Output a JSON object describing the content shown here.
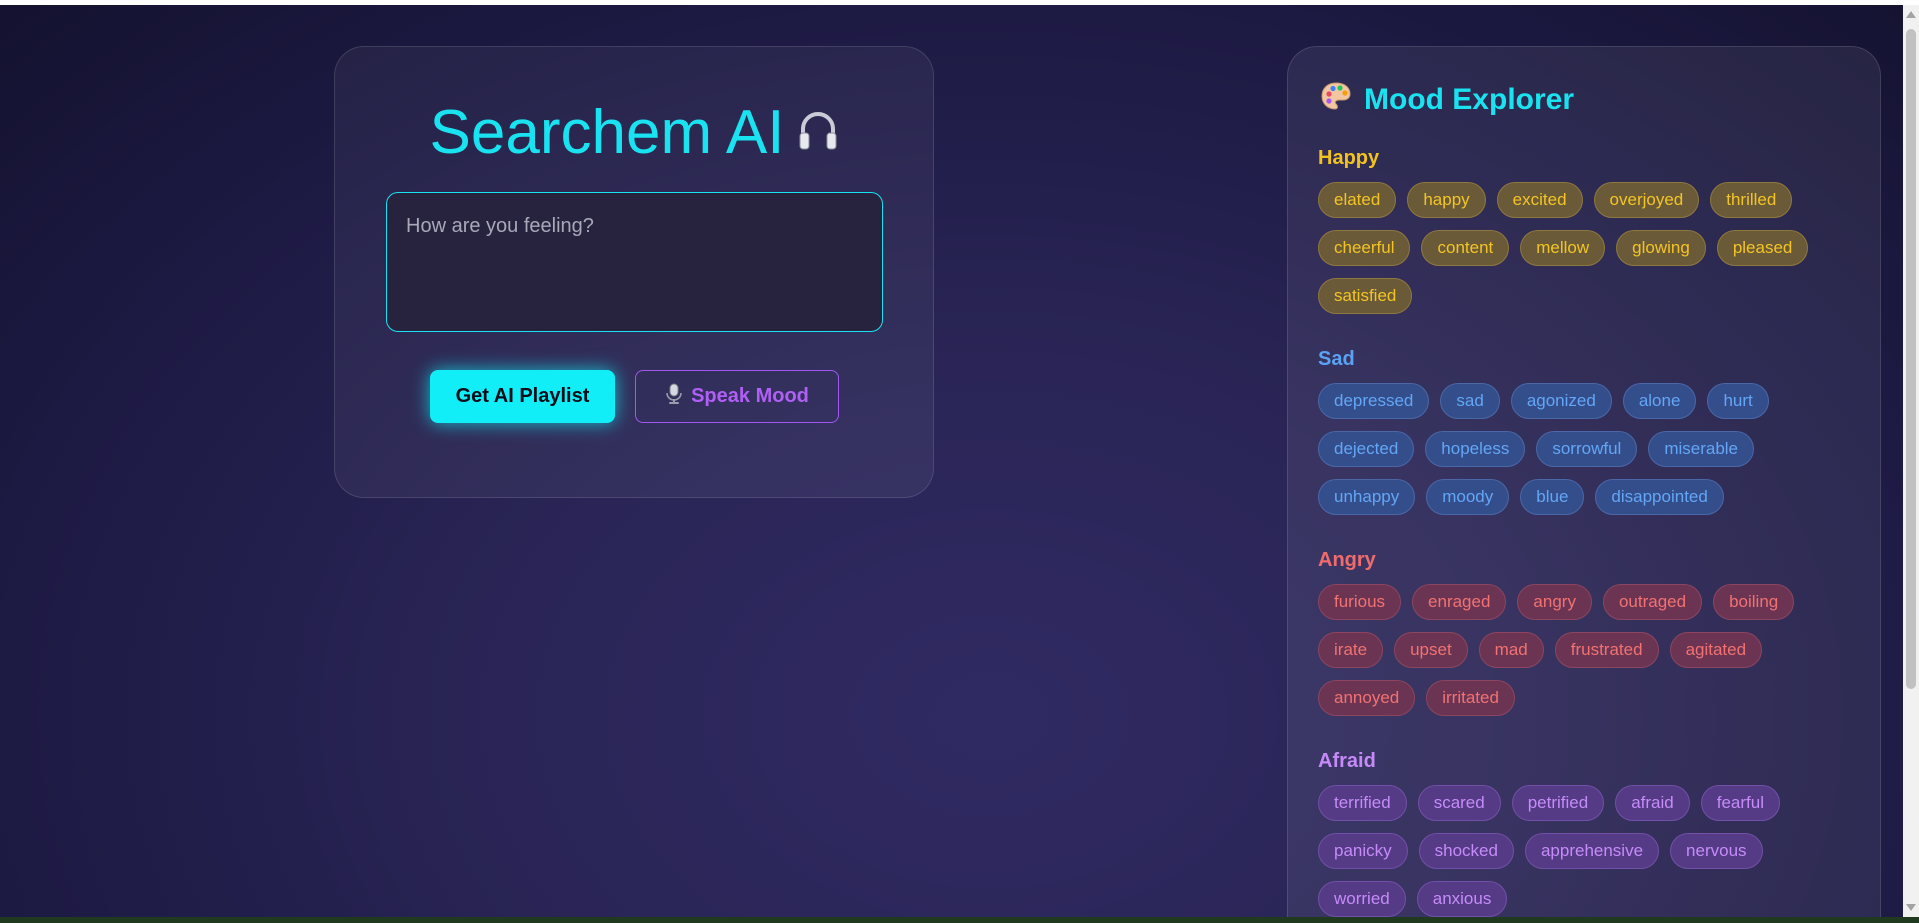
{
  "colors": {
    "accent": "#19e3f0",
    "secondary": "#b05ff5",
    "happy": "#f3c524",
    "sad": "#63a6f5",
    "angry": "#f27272",
    "afraid": "#c58cf8"
  },
  "search": {
    "title": "Searchem AI",
    "title_icon": "headphones-icon",
    "input_value": "",
    "input_placeholder": "How are you feeling?",
    "primary_button": "Get AI Playlist",
    "secondary_button": "Speak Mood",
    "secondary_button_icon": "microphone-icon"
  },
  "explorer": {
    "title": "Mood Explorer",
    "title_icon": "palette-icon",
    "moods": [
      {
        "name": "Happy",
        "words": [
          "elated",
          "happy",
          "excited",
          "overjoyed",
          "thrilled",
          "cheerful",
          "content",
          "mellow",
          "glowing",
          "pleased",
          "satisfied"
        ]
      },
      {
        "name": "Sad",
        "words": [
          "depressed",
          "sad",
          "agonized",
          "alone",
          "hurt",
          "dejected",
          "hopeless",
          "sorrowful",
          "miserable",
          "unhappy",
          "moody",
          "blue",
          "disappointed"
        ]
      },
      {
        "name": "Angry",
        "words": [
          "furious",
          "enraged",
          "angry",
          "outraged",
          "boiling",
          "irate",
          "upset",
          "mad",
          "frustrated",
          "agitated",
          "annoyed",
          "irritated"
        ]
      },
      {
        "name": "Afraid",
        "words": [
          "terrified",
          "scared",
          "petrified",
          "afraid",
          "fearful",
          "panicky",
          "shocked",
          "apprehensive",
          "nervous",
          "worried",
          "anxious"
        ]
      }
    ]
  }
}
